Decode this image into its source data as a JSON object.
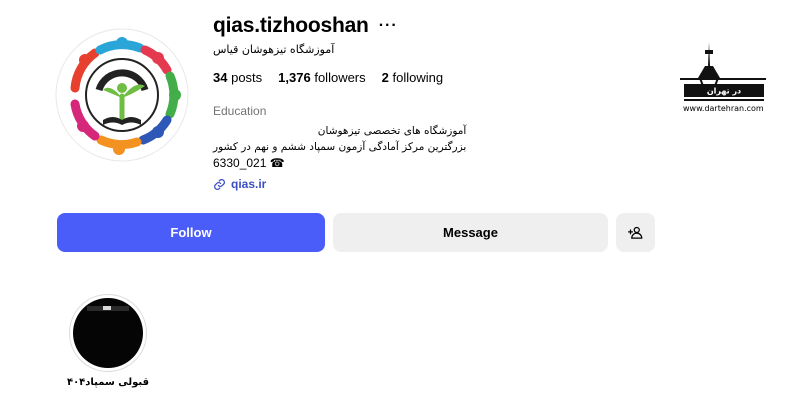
{
  "profile": {
    "username": "qias.tizhooshan",
    "more_label": "···",
    "full_name": "آموزشگاه تیزهوشان قیاس",
    "stats": {
      "posts_count": "34",
      "posts_label": "posts",
      "followers_count": "1,376",
      "followers_label": "followers",
      "following_count": "2",
      "following_label": "following"
    },
    "category": "Education",
    "bio": {
      "line1": "آموزشگاه های تخصصی تیزهوشان",
      "line2": "بزرگترین مرکز آمادگی آزمون سمپاد ششم و نهم در کشور",
      "line3": "6330_021 ☎"
    },
    "link": "qias.ir"
  },
  "buttons": {
    "follow": "Follow",
    "message": "Message"
  },
  "watermark": {
    "logo_text": "در تهران",
    "url": "www.dartehran.com"
  },
  "highlights": [
    {
      "title": "قبولی سمپاد۴۰۴"
    }
  ],
  "icons": {
    "link": "link-icon",
    "add_user": "add-user-icon",
    "more": "more-icon"
  },
  "colors": {
    "follow_button": "#4a5df9",
    "secondary_button": "#efefef",
    "link": "#3b4fc4",
    "category": "#737373"
  }
}
